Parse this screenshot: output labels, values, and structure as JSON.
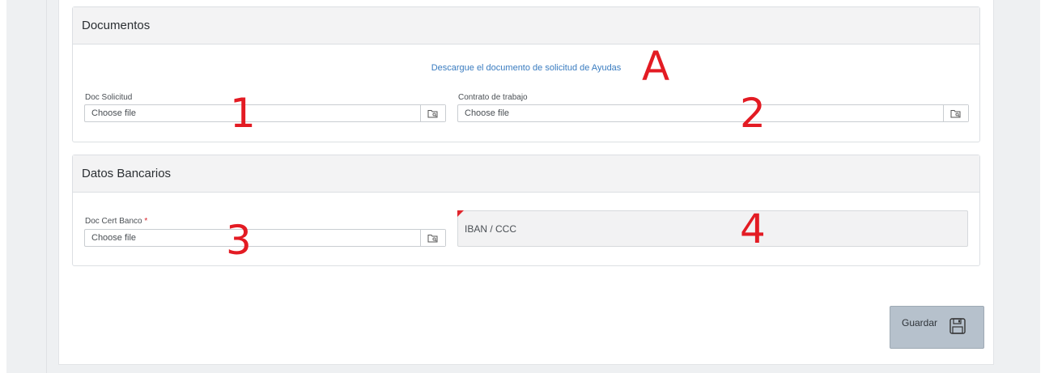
{
  "documentos": {
    "title": "Documentos",
    "download_link": "Descargue el documento de solicitud de Ayudas",
    "doc_solicitud": {
      "label": "Doc Solicitud",
      "placeholder": "Choose file"
    },
    "contrato": {
      "label": "Contrato de trabajo",
      "placeholder": "Choose file"
    }
  },
  "datos_bancarios": {
    "title": "Datos Bancarios",
    "doc_cert_banco": {
      "label": "Doc Cert Banco",
      "required_mark": "*",
      "placeholder": "Choose file"
    },
    "iban": {
      "placeholder": "IBAN / CCC"
    }
  },
  "actions": {
    "save_label": "Guardar"
  },
  "markers": {
    "a": "A",
    "one": "1",
    "two": "2",
    "three": "3",
    "four": "4"
  },
  "colors": {
    "marker": "#e31b23",
    "link": "#3a7cc0",
    "required": "#d9222a",
    "button": "#b6c1cc"
  }
}
